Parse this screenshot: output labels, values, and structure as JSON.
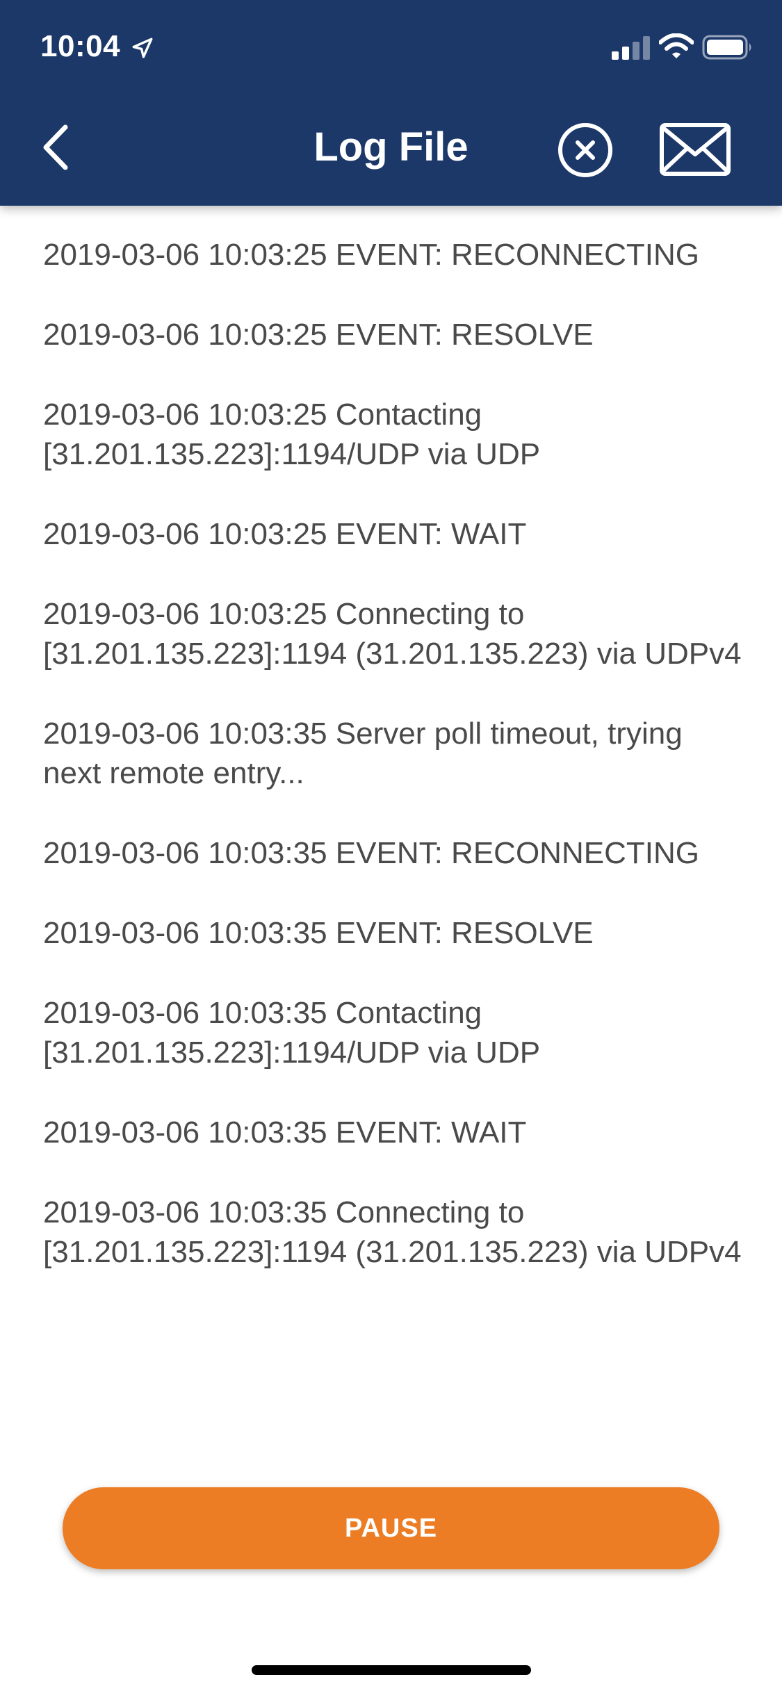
{
  "status_bar": {
    "time": "10:04",
    "icons": [
      "location-arrow-icon",
      "signal-icon",
      "wifi-icon",
      "battery-icon"
    ]
  },
  "header": {
    "title": "Log File",
    "back_icon": "chevron-left-icon",
    "clear_icon": "close-circle-icon",
    "mail_icon": "envelope-icon",
    "background_color": "#1c3869"
  },
  "log": {
    "entries": [
      "2019-03-06 10:03:25 EVENT: RECONNECTING",
      "2019-03-06 10:03:25 EVENT: RESOLVE",
      "2019-03-06 10:03:25 Contacting [31.201.135.223]:1194/UDP via UDP",
      "2019-03-06 10:03:25 EVENT: WAIT",
      "2019-03-06 10:03:25 Connecting to [31.201.135.223]:1194 (31.201.135.223) via UDPv4",
      "2019-03-06 10:03:35 Server poll timeout, trying next remote entry...",
      "2019-03-06 10:03:35 EVENT: RECONNECTING",
      "2019-03-06 10:03:35 EVENT: RESOLVE",
      "2019-03-06 10:03:35 Contacting [31.201.135.223]:1194/UDP via UDP",
      "2019-03-06 10:03:35 EVENT: WAIT",
      "2019-03-06 10:03:35 Connecting to [31.201.135.223]:1194 (31.201.135.223) via UDPv4"
    ]
  },
  "footer": {
    "pause_label": "PAUSE",
    "accent_color": "#ec7d25"
  }
}
